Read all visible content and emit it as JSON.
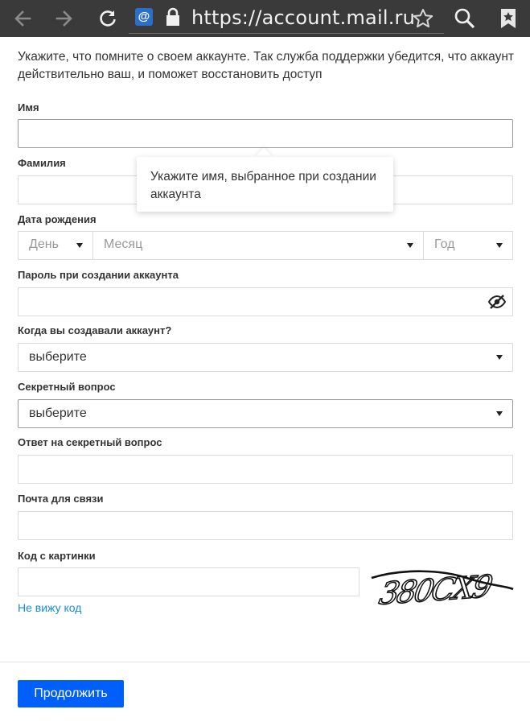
{
  "browser": {
    "url": "https://account.mail.ru",
    "favicon": "@"
  },
  "intro": "Укажите, что помните о своем аккаунте. Так служба поддержки убедится, что аккаунт действительно ваш, и поможет восстановить доступ",
  "fields": {
    "first_name_label": "Имя",
    "last_name_label": "Фамилия",
    "dob_label": "Дата рождения",
    "dob_day": "День",
    "dob_month": "Месяц",
    "dob_year": "Год",
    "password_label": "Пароль при создании аккаунта",
    "created_label": "Когда вы создавали аккаунт?",
    "created_value": "выберите",
    "secret_q_label": "Секретный вопрос",
    "secret_q_value": "выберите",
    "answer_label": "Ответ на секретный вопрос",
    "contact_email_label": "Почта для связи",
    "captcha_label": "Код с картинки",
    "captcha_image_text": "380CX9",
    "cant_see_link": "Не вижу код"
  },
  "tooltip": "Укажите имя, выбранное при создании аккаунта",
  "submit_label": "Продолжить",
  "colors": {
    "accent": "#005ff9",
    "link": "#168de2",
    "toolbar": "#3a3a3a"
  }
}
